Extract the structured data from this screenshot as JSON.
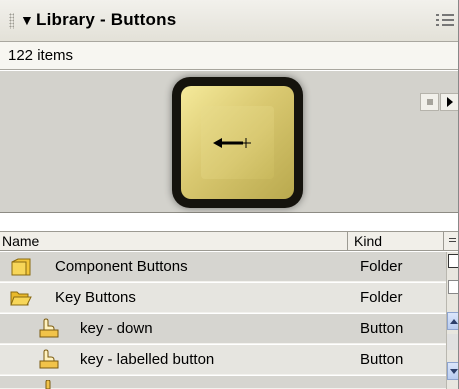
{
  "panel": {
    "title": "Library - Buttons",
    "collapse_icon": "triangle-down-icon",
    "options_icon": "options-menu-icon"
  },
  "status": {
    "item_count": "122 items"
  },
  "preview": {
    "symbol": "key-arrow-button",
    "controls": {
      "stop_icon": "stop-icon",
      "play_icon": "play-icon"
    }
  },
  "list": {
    "columns": {
      "name": "Name",
      "kind": "Kind"
    },
    "rows": [
      {
        "name": "Component Buttons",
        "kind": "Folder",
        "icon": "folder-closed-icon"
      },
      {
        "name": "Key Buttons",
        "kind": "Folder",
        "icon": "folder-open-icon"
      },
      {
        "name": "key - down",
        "kind": "Button",
        "icon": "button-symbol-icon"
      },
      {
        "name": "key - labelled button",
        "kind": "Button",
        "icon": "button-symbol-icon"
      }
    ]
  },
  "colors": {
    "folder": "#f3c63a",
    "button_symbol": "#f1c34a",
    "key_gold": "#d9c870"
  }
}
